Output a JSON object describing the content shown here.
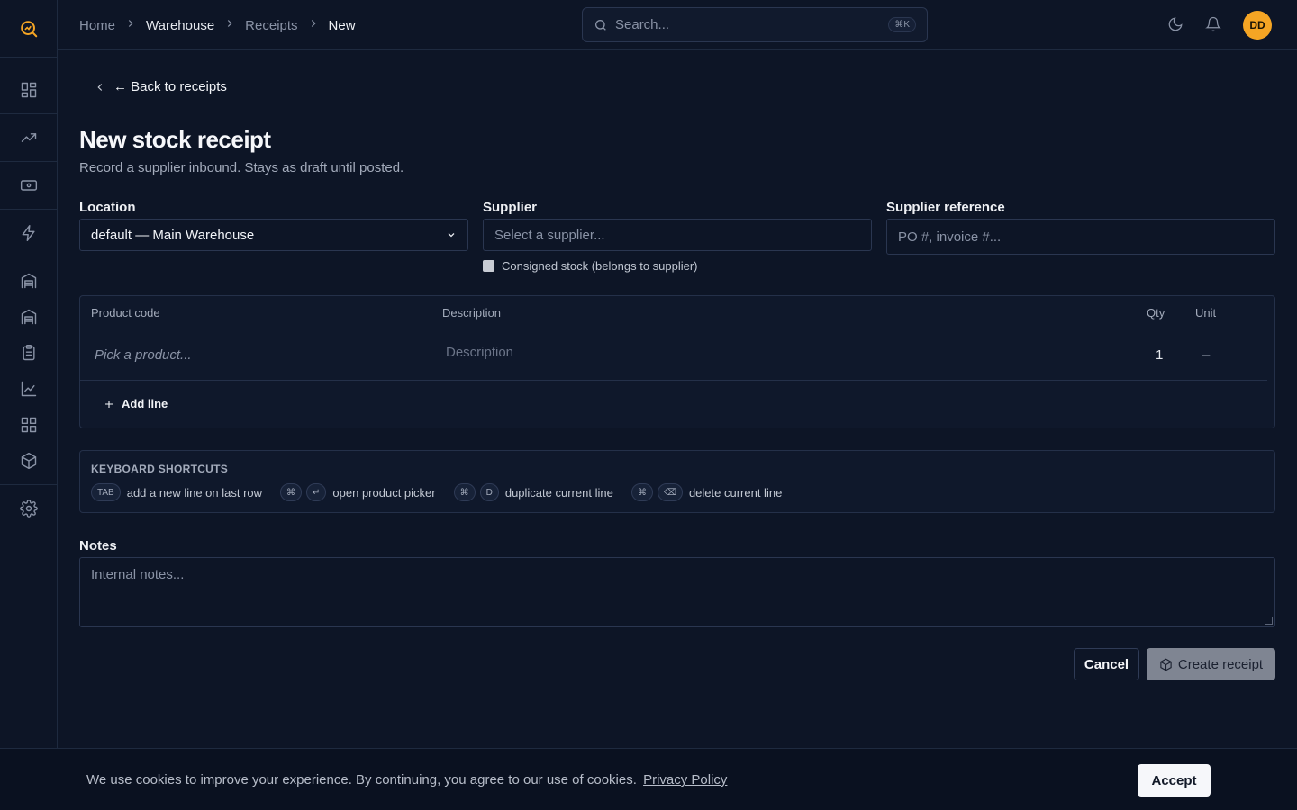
{
  "colors": {
    "accent": "#f5a524",
    "background": "#0d1526",
    "border": "#2a3650"
  },
  "breadcrumb": [
    {
      "label": "Home"
    },
    {
      "label": "Warehouse"
    },
    {
      "label": "Receipts"
    },
    {
      "label": "New"
    }
  ],
  "search": {
    "placeholder": "Search...",
    "shortcut": "⌘K"
  },
  "user": {
    "initials": "DD"
  },
  "back_link": "← Back to receipts",
  "page": {
    "title": "New stock receipt",
    "subtitle": "Record a supplier inbound. Stays as draft until posted."
  },
  "form": {
    "location": {
      "label": "Location",
      "value": "default — Main Warehouse"
    },
    "supplier": {
      "label": "Supplier",
      "placeholder": "Select a supplier..."
    },
    "supplier_ref": {
      "label": "Supplier reference",
      "placeholder": "PO #, invoice #..."
    },
    "consigned_label": "Consigned stock (belongs to supplier)",
    "consigned_checked": false
  },
  "lines": {
    "headers": {
      "product": "Product code",
      "description": "Description",
      "qty": "Qty",
      "unit": "Unit"
    },
    "rows": [
      {
        "product_placeholder": "Pick a product...",
        "description_placeholder": "Description",
        "qty": "1",
        "unit": "–"
      }
    ],
    "add_label": "Add line"
  },
  "shortcuts": {
    "title": "KEYBOARD SHORTCUTS",
    "items": [
      {
        "keys": [
          "TAB"
        ],
        "text": "add a new line on last row"
      },
      {
        "keys": [
          "⌘",
          "↵"
        ],
        "text": "open product picker"
      },
      {
        "keys": [
          "⌘",
          "D"
        ],
        "text": "duplicate current line"
      },
      {
        "keys": [
          "⌘",
          "⌫"
        ],
        "text": "delete current line"
      }
    ]
  },
  "notes": {
    "label": "Notes",
    "placeholder": "Internal notes..."
  },
  "actions": {
    "cancel": "Cancel",
    "create": "Create receipt"
  },
  "cookie": {
    "text": "We use cookies to improve your experience. By continuing, you agree to our use of cookies.",
    "link": "Privacy Policy",
    "accept": "Accept"
  },
  "sidebar_icons": [
    "dashboard-icon",
    "trending-up-icon",
    "banknote-icon",
    "zap-icon",
    "warehouse-icon",
    "warehouse-alt-icon",
    "clipboard-icon",
    "line-chart-icon",
    "grid-icon",
    "package-icon",
    "settings-icon"
  ]
}
